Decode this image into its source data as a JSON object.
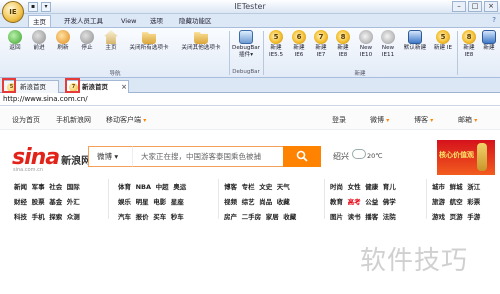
{
  "app": {
    "orb_label": "IE",
    "title": "IETester",
    "help": "?"
  },
  "window_controls": [
    "–",
    "□",
    "×"
  ],
  "qat": [
    "▪",
    "▾"
  ],
  "ribbon_tabs": [
    {
      "label": "主页",
      "active": true
    },
    {
      "label": "开发人员工具",
      "active": false
    },
    {
      "label": "View",
      "active": false
    },
    {
      "label": "选项",
      "active": false
    },
    {
      "label": "隐藏功能区",
      "active": false
    }
  ],
  "ribbon": {
    "nav_buttons": [
      {
        "label": "返回",
        "icon": "back-arrow-icon"
      },
      {
        "label": "前进",
        "icon": "forward-arrow-icon"
      },
      {
        "label": "刷新",
        "icon": "refresh-icon"
      },
      {
        "label": "停止",
        "icon": "stop-icon"
      },
      {
        "label": "主页",
        "icon": "home-icon"
      },
      {
        "label": "关闭所有选项卡",
        "icon": "folder-icon"
      },
      {
        "label": "关闭其他选项卡",
        "icon": "folder-icon"
      }
    ],
    "nav_group_label": "导航",
    "debug_button": {
      "label": "DebugBar 插件▾",
      "icon": "debugbar-icon"
    },
    "debug_group_label": "DebugBar",
    "new_buttons": [
      {
        "label": "新建 IE5.5",
        "icon": "ie-icon",
        "badge": "5"
      },
      {
        "label": "新建 IE6",
        "icon": "ie-icon",
        "badge": "6"
      },
      {
        "label": "新建 IE7",
        "icon": "ie-icon",
        "badge": "7"
      },
      {
        "label": "新建 IE8",
        "icon": "ie-icon",
        "badge": "8"
      },
      {
        "label": "New IE10",
        "icon": "ie-gray-icon",
        "badge": ""
      },
      {
        "label": "New IE11",
        "icon": "ie-gray-icon",
        "badge": ""
      },
      {
        "label": "默认新建",
        "icon": "default-new-icon",
        "badge": ""
      },
      {
        "label": "新建 IE",
        "icon": "ie-icon",
        "badge": "5"
      }
    ],
    "new_group_label": "新建",
    "new_more": "新建 IE8",
    "right_button": {
      "label": "新建",
      "icon": "more-icon"
    }
  },
  "browser_tabs": [
    {
      "label": "新浪首页",
      "active": false,
      "close": ""
    },
    {
      "label": "新浪首页",
      "active": true,
      "close": "×"
    }
  ],
  "address": "http://www.sina.com.cn/",
  "page": {
    "top_links_left": [
      {
        "label": "设为首页"
      },
      {
        "label": "手机新浪网"
      },
      {
        "label": "移动客户端",
        "caret": "▾"
      }
    ],
    "top_links_right": [
      {
        "label": "登录"
      },
      {
        "label": "微博",
        "caret": "▾"
      },
      {
        "label": "博客",
        "caret": "▾"
      },
      {
        "label": "邮箱",
        "caret": "▾"
      }
    ],
    "logo_text": "sina",
    "logo_cn": "新浪网",
    "logo_sub": "sina.com.cn",
    "search_type": "微博 ▾",
    "search_placeholder": "大家正在搜，中国游客泰国乘色被捕",
    "weather_city": "绍兴",
    "weather_temp": "20℃",
    "promo_text": "核心价值观",
    "nav_columns": [
      {
        "rows": [
          [
            "新闻",
            "军事",
            "社会",
            "国际"
          ],
          [
            "财经",
            "股票",
            "基金",
            "外汇"
          ],
          [
            "科技",
            "手机",
            "探索",
            "众测"
          ]
        ]
      },
      {
        "rows": [
          [
            "体育",
            "NBA",
            "中超",
            "奥运"
          ],
          [
            "娱乐",
            "明星",
            "电影",
            "星座"
          ],
          [
            "汽车",
            "报价",
            "买车",
            "秒车"
          ]
        ]
      },
      {
        "rows": [
          [
            "博客",
            "专栏",
            "文史",
            "天气"
          ],
          [
            "视频",
            "综艺",
            "尚品",
            "收藏"
          ],
          [
            "房产",
            "二手房",
            "家居",
            "收藏"
          ]
        ]
      },
      {
        "rows": [
          [
            "时尚",
            "女性",
            "健康",
            "育儿"
          ],
          [
            "教育",
            "读书",
            "公益",
            "佛学"
          ],
          [
            "图片",
            "读书",
            "播客",
            "法院"
          ]
        ]
      },
      {
        "rows": [
          [
            "城市",
            "鲜城",
            "浙江"
          ],
          [
            "旅游",
            "航空",
            "彩票"
          ],
          [
            "游戏",
            "页游",
            "手游"
          ]
        ]
      }
    ],
    "nav_red_word": "高考"
  },
  "watermark": "软件技巧"
}
